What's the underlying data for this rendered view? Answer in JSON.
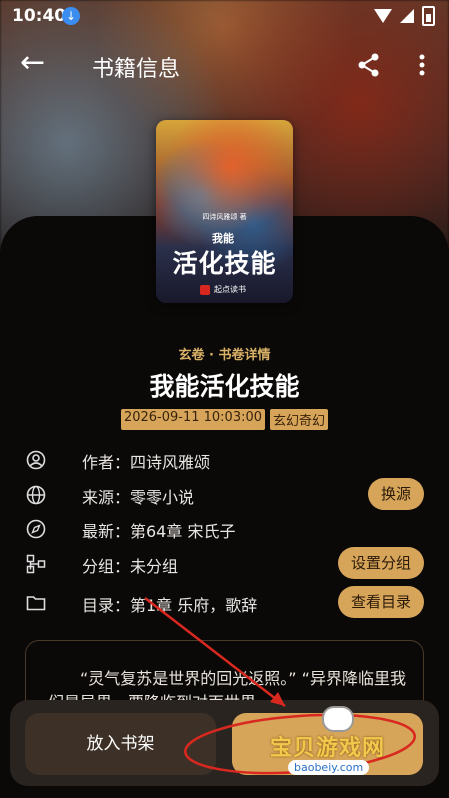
{
  "status_bar": {
    "time": "10:40",
    "download_icon": "download-icon",
    "wifi_icon": "wifi-icon",
    "signal_icon": "signal-icon",
    "battery_icon": "battery-icon"
  },
  "app_bar": {
    "title": "书籍信息",
    "back_icon": "arrow-left-icon",
    "share_icon": "share-icon",
    "more_icon": "more-vertical-icon"
  },
  "cover": {
    "author": "四诗风雅颂 著",
    "title_small": "我能",
    "title_big": "活化技能",
    "publisher": "起点读书"
  },
  "book": {
    "kicker": "玄卷 · 书卷详情",
    "title": "我能活化技能",
    "tags": [
      "2026-09-11 10:03:00",
      "玄幻奇幻"
    ]
  },
  "info_rows": [
    {
      "icon": "user-icon",
      "text": "作者：四诗风雅颂"
    },
    {
      "icon": "globe-icon",
      "text": "来源：零零小说",
      "action": "换源"
    },
    {
      "icon": "compass-icon",
      "text": "最新：第64章 宋氏子"
    },
    {
      "icon": "group-icon",
      "text": "分组：未分组",
      "action": "设置分组"
    },
    {
      "icon": "folder-icon",
      "text": "目录：第1章 乐府，歌辞",
      "action": "查看目录"
    }
  ],
  "intro": {
    "text": "“灵气复苏是世界的回光返照。” “异界降临里我们是异界，要降临到对面世界"
  },
  "bottom": {
    "add_shelf": "放入书架",
    "read": ""
  },
  "watermark": {
    "text": "宝贝游戏网",
    "url": "baobeiy.com"
  },
  "colors": {
    "accent": "#d6a55a",
    "background": "#0b0908"
  }
}
